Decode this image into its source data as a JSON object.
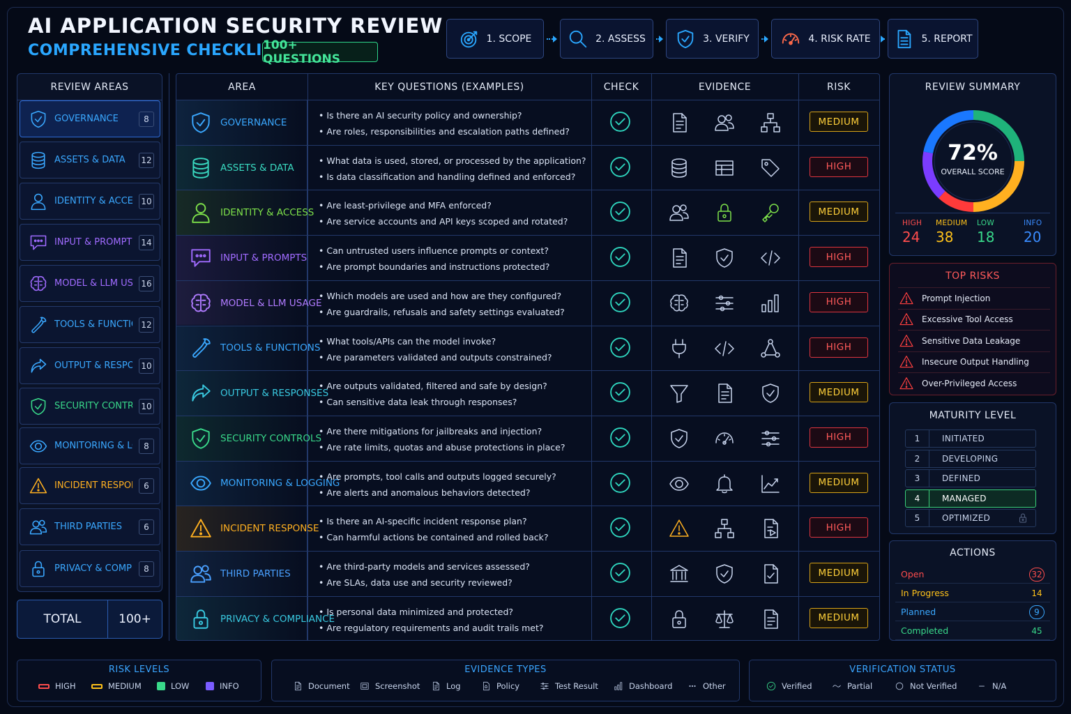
{
  "header": {
    "title": "AI APPLICATION SECURITY REVIEW",
    "subtitle": "COMPREHENSIVE CHECKLIST",
    "badge": "100+ QUESTIONS"
  },
  "steps": [
    {
      "label": "1. SCOPE",
      "icon": "target-icon"
    },
    {
      "label": "2. ASSESS",
      "icon": "magnifier-icon"
    },
    {
      "label": "3. VERIFY",
      "icon": "shield-check-icon"
    },
    {
      "label": "4. RISK RATE",
      "icon": "gauge-icon"
    },
    {
      "label": "5. REPORT",
      "icon": "report-icon"
    }
  ],
  "sidebar": {
    "title": "REVIEW AREAS",
    "items": [
      {
        "label": "GOVERNANCE",
        "count": "8",
        "color": "#3aa8ff",
        "icon": "shield-check-icon"
      },
      {
        "label": "ASSETS & DATA",
        "count": "12",
        "color": "#3aa8ff",
        "icon": "database-icon"
      },
      {
        "label": "IDENTITY & ACCESS",
        "count": "10",
        "color": "#3aa8ff",
        "icon": "user-icon"
      },
      {
        "label": "INPUT & PROMPTS",
        "count": "14",
        "color": "#a06bff",
        "icon": "chat-icon"
      },
      {
        "label": "MODEL & LLM USAGE",
        "count": "16",
        "color": "#a06bff",
        "icon": "brain-icon"
      },
      {
        "label": "TOOLS & FUNCTIONS",
        "count": "12",
        "color": "#3aa8ff",
        "icon": "wrench-icon"
      },
      {
        "label": "OUTPUT & RESPONSES",
        "count": "10",
        "color": "#3aa8ff",
        "icon": "share-arrow-icon"
      },
      {
        "label": "SECURITY CONTROLS",
        "count": "10",
        "color": "#39d98a",
        "icon": "shield-check-icon"
      },
      {
        "label": "MONITORING & LOGGING",
        "count": "8",
        "color": "#3aa8ff",
        "icon": "eye-icon"
      },
      {
        "label": "INCIDENT RESPONSE",
        "count": "6",
        "color": "#ffb020",
        "icon": "warning-icon"
      },
      {
        "label": "THIRD PARTIES",
        "count": "6",
        "color": "#3aa8ff",
        "icon": "users-icon"
      },
      {
        "label": "PRIVACY & COMPLIANCE",
        "count": "8",
        "color": "#3aa8ff",
        "icon": "lock-icon"
      }
    ],
    "total_label": "TOTAL",
    "total_value": "100+"
  },
  "table": {
    "headers": {
      "area": "AREA",
      "questions": "KEY QUESTIONS (EXAMPLES)",
      "check": "CHECK",
      "evidence": "EVIDENCE",
      "risk": "RISK"
    },
    "rows": [
      {
        "area": "GOVERNANCE",
        "color": "#3aa8ff",
        "icon": "shield-check-icon",
        "q1": "• Is there an AI security policy and ownership?",
        "q2": "• Are roles, responsibilities and escalation paths defined?",
        "evidence": [
          "document-icon",
          "users-icon",
          "org-chart-icon"
        ],
        "risk": "MEDIUM"
      },
      {
        "area": "ASSETS & DATA",
        "color": "#39d9c0",
        "icon": "database-icon",
        "q1": "• What data is used, stored, or processed by the application?",
        "q2": "• Is data classification and handling defined and enforced?",
        "evidence": [
          "database-icon",
          "table-icon",
          "tag-icon"
        ],
        "risk": "HIGH"
      },
      {
        "area": "IDENTITY & ACCESS",
        "color": "#7ee24a",
        "icon": "user-icon",
        "q1": "• Are least-privilege and MFA enforced?",
        "q2": "• Are service accounts and API keys scoped and rotated?",
        "evidence": [
          "users-icon",
          "lock-icon",
          "key-icon"
        ],
        "risk": "MEDIUM"
      },
      {
        "area": "INPUT & PROMPTS",
        "color": "#a06bff",
        "icon": "chat-icon",
        "q1": "• Can untrusted users influence prompts or context?",
        "q2": "• Are prompt boundaries and instructions protected?",
        "evidence": [
          "document-icon",
          "shield-check-icon",
          "code-icon"
        ],
        "risk": "HIGH"
      },
      {
        "area": "MODEL & LLM USAGE",
        "color": "#b07bff",
        "icon": "brain-icon",
        "q1": "• Which models are used and how are they configured?",
        "q2": "• Are guardrails, refusals and safety settings evaluated?",
        "evidence": [
          "brain-icon",
          "sliders-icon",
          "bar-chart-icon"
        ],
        "risk": "HIGH"
      },
      {
        "area": "TOOLS & FUNCTIONS",
        "color": "#3aa8ff",
        "icon": "wrench-icon",
        "q1": "• What tools/APIs can the model invoke?",
        "q2": "• Are parameters validated and outputs constrained?",
        "evidence": [
          "plug-icon",
          "code-icon",
          "network-icon"
        ],
        "risk": "HIGH"
      },
      {
        "area": "OUTPUT & RESPONSES",
        "color": "#39c9e0",
        "icon": "share-arrow-icon",
        "q1": "• Are outputs validated, filtered and safe by design?",
        "q2": "• Can sensitive data leak through responses?",
        "evidence": [
          "filter-icon",
          "document-icon",
          "shield-check-icon"
        ],
        "risk": "MEDIUM"
      },
      {
        "area": "SECURITY CONTROLS",
        "color": "#39d98a",
        "icon": "shield-check-icon",
        "q1": "• Are there mitigations for jailbreaks and injection?",
        "q2": "• Are rate limits, quotas and abuse protections in place?",
        "evidence": [
          "shield-check-icon",
          "gauge-icon",
          "sliders-icon"
        ],
        "risk": "HIGH"
      },
      {
        "area": "MONITORING & LOGGING",
        "color": "#3aa8ff",
        "icon": "eye-icon",
        "q1": "• Are prompts, tool calls and outputs logged securely?",
        "q2": "• Are alerts and anomalous behaviors detected?",
        "evidence": [
          "eye-icon",
          "bell-icon",
          "line-chart-icon"
        ],
        "risk": "MEDIUM"
      },
      {
        "area": "INCIDENT RESPONSE",
        "color": "#ffb020",
        "icon": "warning-icon",
        "q1": "• Is there an AI-specific incident response plan?",
        "q2": "• Can harmful actions be contained and rolled back?",
        "evidence": [
          "warning-icon",
          "org-chart-icon",
          "document-play-icon"
        ],
        "risk": "HIGH"
      },
      {
        "area": "THIRD PARTIES",
        "color": "#4aa0ff",
        "icon": "users-icon",
        "q1": "• Are third-party models and services assessed?",
        "q2": "• Are SLAs, data use and security reviewed?",
        "evidence": [
          "bank-icon",
          "shield-check-icon",
          "document-check-icon"
        ],
        "risk": "MEDIUM"
      },
      {
        "area": "PRIVACY & COMPLIANCE",
        "color": "#39c9e0",
        "icon": "lock-icon",
        "q1": "• Is personal data minimized and protected?",
        "q2": "• Are regulatory requirements and audit trails met?",
        "evidence": [
          "lock-icon",
          "scales-icon",
          "document-icon"
        ],
        "risk": "MEDIUM"
      }
    ]
  },
  "summary": {
    "title": "REVIEW SUMMARY",
    "score": "72%",
    "score_value": 72,
    "score_label": "OVERALL SCORE",
    "counts": [
      {
        "label": "HIGH",
        "value": "24",
        "color": "#ff4d4d"
      },
      {
        "label": "MEDIUM",
        "value": "38",
        "color": "#ffc21a"
      },
      {
        "label": "LOW",
        "value": "18",
        "color": "#39d98a"
      },
      {
        "label": "INFO",
        "value": "20",
        "color": "#3a8cff"
      }
    ]
  },
  "top_risks": {
    "title": "TOP RISKS",
    "items": [
      "Prompt Injection",
      "Excessive Tool Access",
      "Sensitive Data Leakage",
      "Insecure Output Handling",
      "Over-Privileged Access"
    ]
  },
  "maturity": {
    "title": "MATURITY LEVEL",
    "levels": [
      {
        "n": "1",
        "label": "INITIATED"
      },
      {
        "n": "2",
        "label": "DEVELOPING"
      },
      {
        "n": "3",
        "label": "DEFINED"
      },
      {
        "n": "4",
        "label": "MANAGED",
        "active": true
      },
      {
        "n": "5",
        "label": "OPTIMIZED",
        "locked": true
      }
    ]
  },
  "actions": {
    "title": "ACTIONS",
    "items": [
      {
        "label": "Open",
        "value": "32",
        "color": "#ff4d4d"
      },
      {
        "label": "In Progress",
        "value": "14",
        "color": "#ffc21a"
      },
      {
        "label": "Planned",
        "value": "9",
        "color": "#3aa8ff"
      },
      {
        "label": "Completed",
        "value": "45",
        "color": "#39d98a"
      }
    ]
  },
  "legends": {
    "risk_levels": {
      "title": "RISK LEVELS",
      "items": [
        {
          "label": "HIGH",
          "color": "#ff4d4d"
        },
        {
          "label": "MEDIUM",
          "color": "#ffc21a"
        },
        {
          "label": "LOW",
          "color": "#39d98a"
        },
        {
          "label": "INFO",
          "color": "#7a5cff"
        }
      ]
    },
    "evidence_types": {
      "title": "EVIDENCE TYPES",
      "items": [
        "Document",
        "Screenshot",
        "Log",
        "Policy",
        "Test Result",
        "Dashboard",
        "Other"
      ]
    },
    "verification_status": {
      "title": "VERIFICATION STATUS",
      "items": [
        "Verified",
        "Partial",
        "Not Verified",
        "N/A"
      ]
    }
  }
}
